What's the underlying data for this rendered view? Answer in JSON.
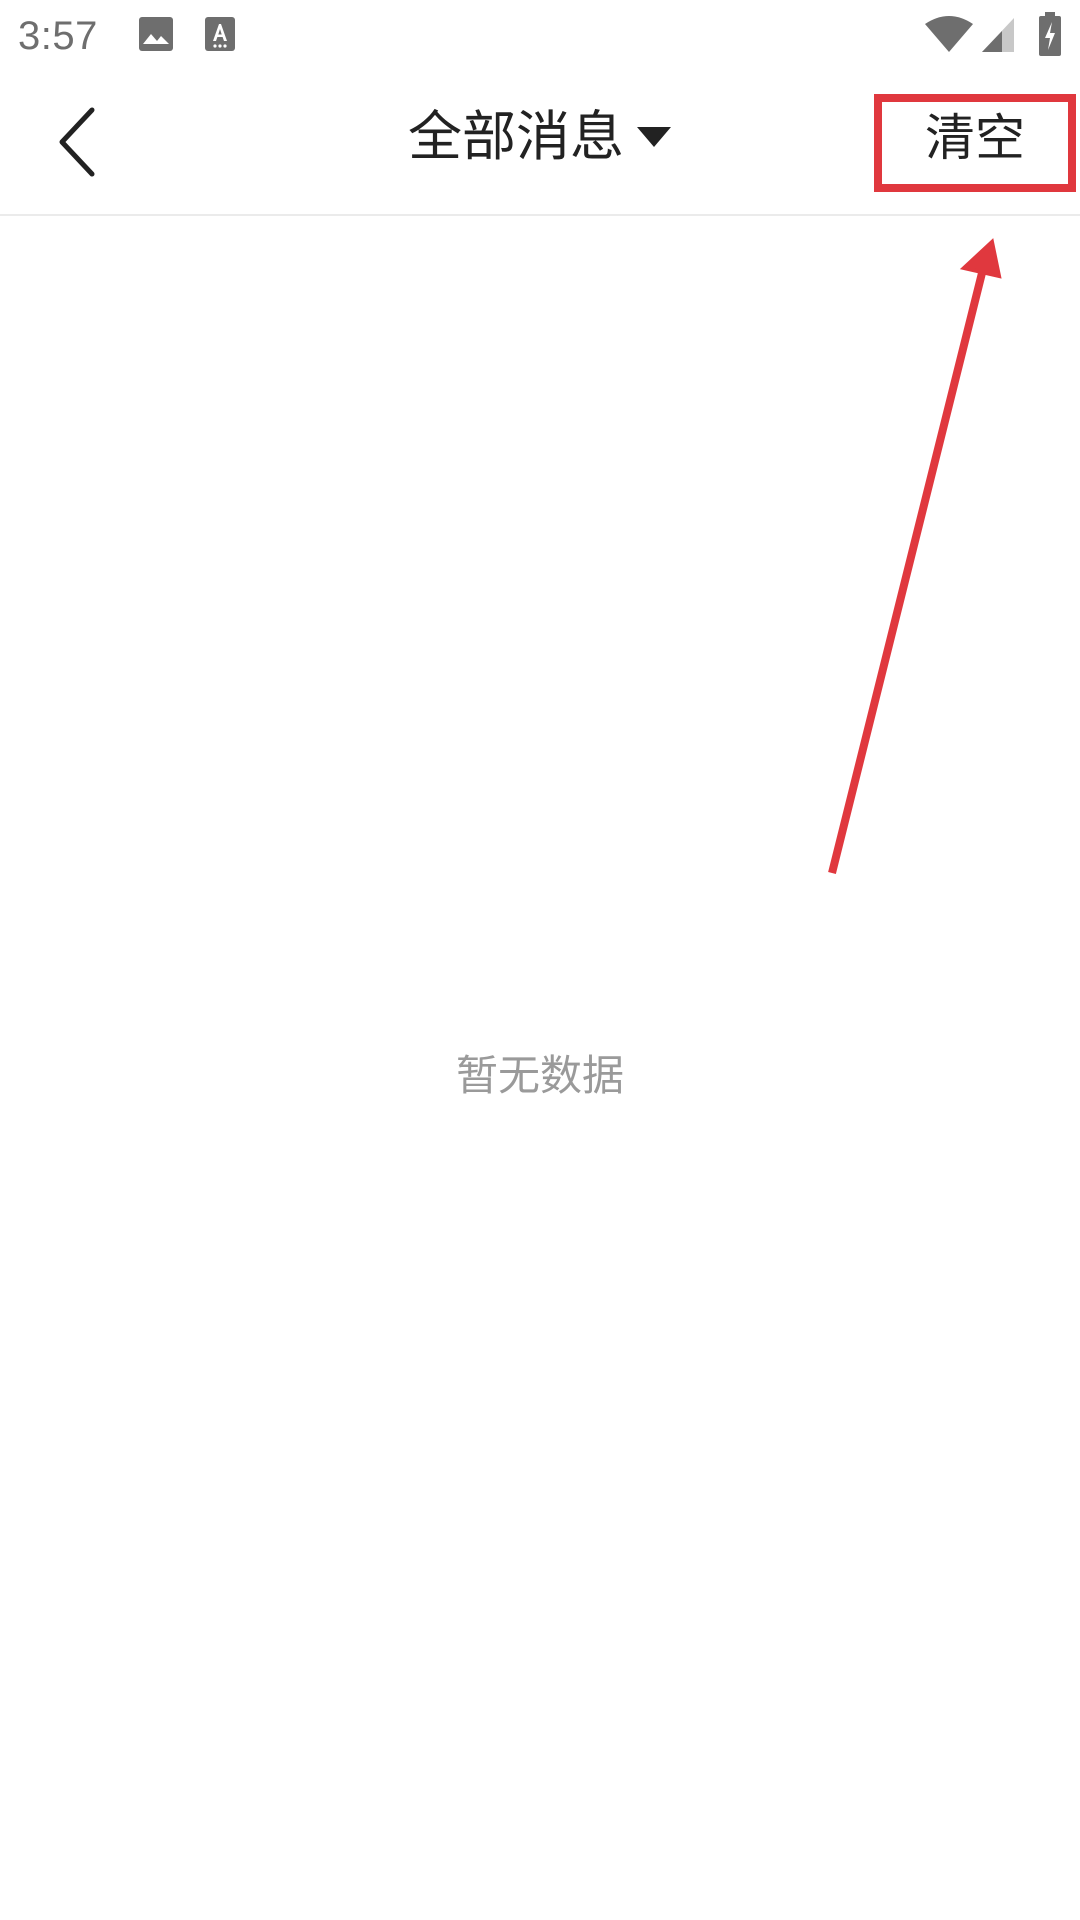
{
  "status_bar": {
    "time": "3:57",
    "icons": [
      "image-icon",
      "a-keyboard-icon",
      "wifi-icon",
      "signal-icon",
      "battery-charging-icon"
    ]
  },
  "header": {
    "back_icon": "chevron-left-icon",
    "title": "全部消息",
    "title_dropdown_icon": "caret-down-icon",
    "clear_label": "清空"
  },
  "content": {
    "empty_text": "暂无数据"
  },
  "annotation": {
    "highlight_color": "#e0383e",
    "target": "clear-button"
  }
}
